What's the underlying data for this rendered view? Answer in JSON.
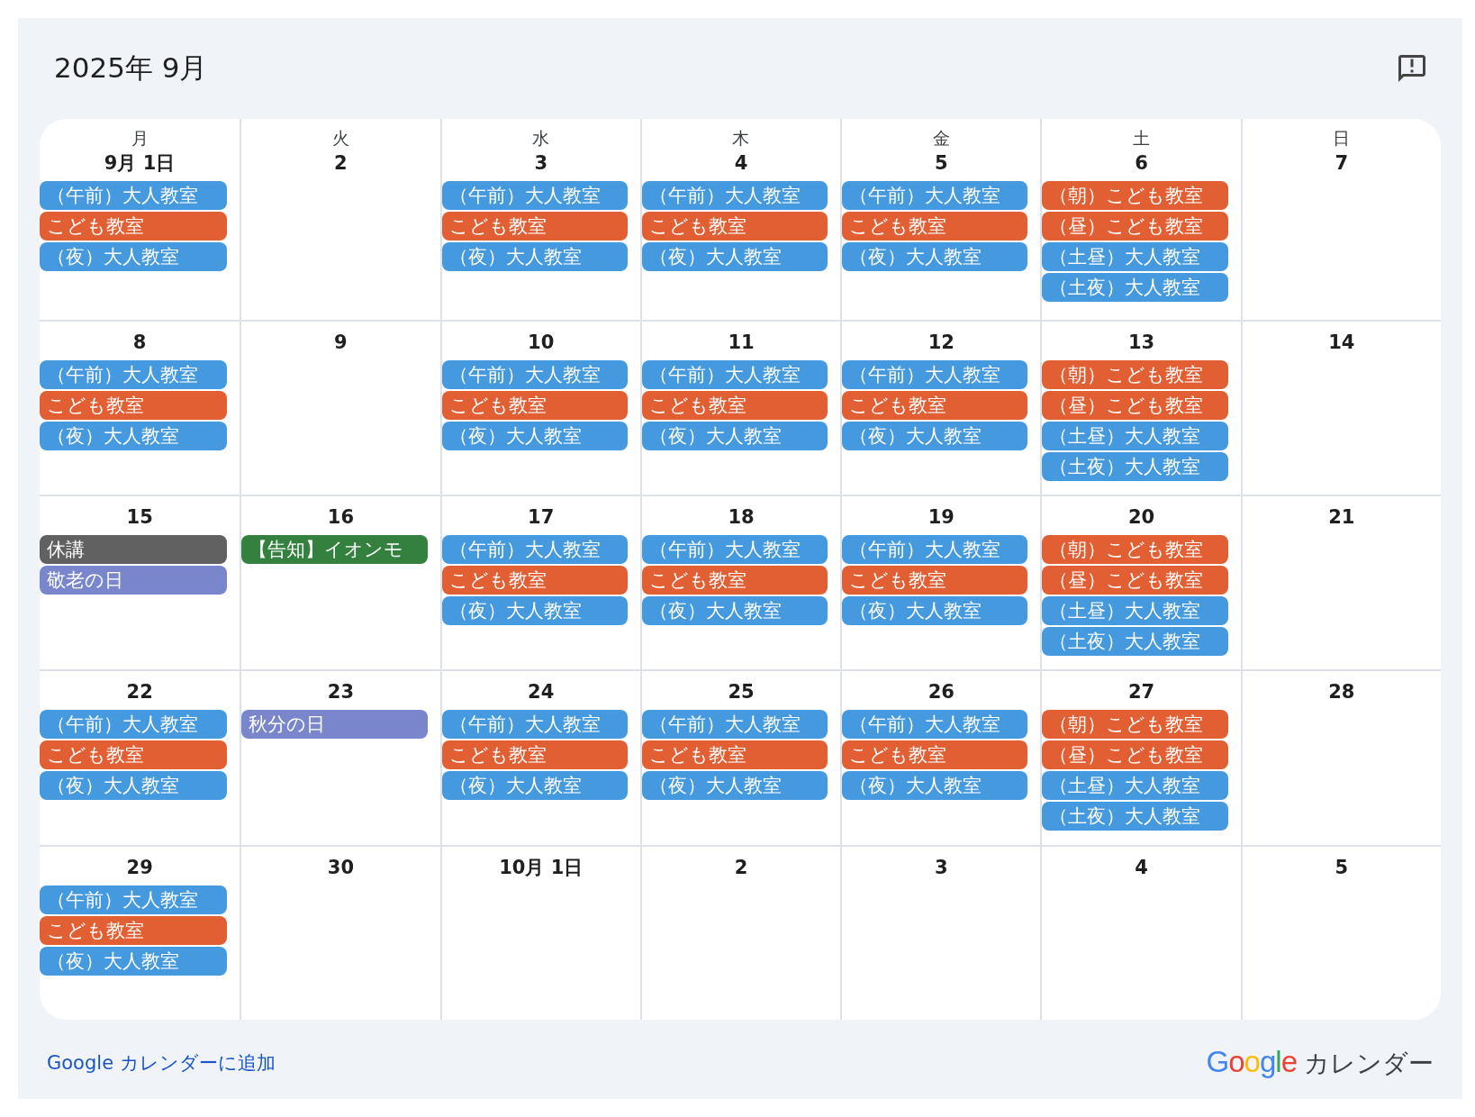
{
  "title": "2025年 9月",
  "weekdays": [
    "月",
    "火",
    "水",
    "木",
    "金",
    "土",
    "日"
  ],
  "weeks": [
    {
      "days": [
        {
          "label": "9月 1日",
          "events": [
            {
              "title": "（午前）大人教室",
              "color": "#4599df"
            },
            {
              "title": "こども教室",
              "color": "#e25e33"
            },
            {
              "title": "（夜）大人教室",
              "color": "#4599df"
            }
          ]
        },
        {
          "label": "2"
        },
        {
          "label": "3",
          "events": [
            {
              "title": "（午前）大人教室",
              "color": "#4599df"
            },
            {
              "title": "こども教室",
              "color": "#e25e33"
            },
            {
              "title": "（夜）大人教室",
              "color": "#4599df"
            }
          ]
        },
        {
          "label": "4",
          "events": [
            {
              "title": "（午前）大人教室",
              "color": "#4599df"
            },
            {
              "title": "こども教室",
              "color": "#e25e33"
            },
            {
              "title": "（夜）大人教室",
              "color": "#4599df"
            }
          ]
        },
        {
          "label": "5",
          "events": [
            {
              "title": "（午前）大人教室",
              "color": "#4599df"
            },
            {
              "title": "こども教室",
              "color": "#e25e33"
            },
            {
              "title": "（夜）大人教室",
              "color": "#4599df"
            }
          ]
        },
        {
          "label": "6",
          "events": [
            {
              "title": "（朝）こども教室",
              "color": "#e25e33"
            },
            {
              "title": "（昼）こども教室",
              "color": "#e25e33"
            },
            {
              "title": "（土昼）大人教室",
              "color": "#4599df"
            },
            {
              "title": "（土夜）大人教室",
              "color": "#4599df"
            }
          ]
        },
        {
          "label": "7"
        }
      ]
    },
    {
      "days": [
        {
          "label": "8",
          "events": [
            {
              "title": "（午前）大人教室",
              "color": "#4599df"
            },
            {
              "title": "こども教室",
              "color": "#e25e33"
            },
            {
              "title": "（夜）大人教室",
              "color": "#4599df"
            }
          ]
        },
        {
          "label": "9"
        },
        {
          "label": "10",
          "events": [
            {
              "title": "（午前）大人教室",
              "color": "#4599df"
            },
            {
              "title": "こども教室",
              "color": "#e25e33"
            },
            {
              "title": "（夜）大人教室",
              "color": "#4599df"
            }
          ]
        },
        {
          "label": "11",
          "events": [
            {
              "title": "（午前）大人教室",
              "color": "#4599df"
            },
            {
              "title": "こども教室",
              "color": "#e25e33"
            },
            {
              "title": "（夜）大人教室",
              "color": "#4599df"
            }
          ]
        },
        {
          "label": "12",
          "events": [
            {
              "title": "（午前）大人教室",
              "color": "#4599df"
            },
            {
              "title": "こども教室",
              "color": "#e25e33"
            },
            {
              "title": "（夜）大人教室",
              "color": "#4599df"
            }
          ]
        },
        {
          "label": "13",
          "events": [
            {
              "title": "（朝）こども教室",
              "color": "#e25e33"
            },
            {
              "title": "（昼）こども教室",
              "color": "#e25e33"
            },
            {
              "title": "（土昼）大人教室",
              "color": "#4599df"
            },
            {
              "title": "（土夜）大人教室",
              "color": "#4599df"
            }
          ]
        },
        {
          "label": "14"
        }
      ]
    },
    {
      "days": [
        {
          "label": "15",
          "events": [
            {
              "title": "休講",
              "color": "#616161"
            },
            {
              "title": "敬老の日",
              "color": "#7986cb"
            }
          ]
        },
        {
          "label": "16",
          "events": [
            {
              "title": "【告知】イオンモ",
              "color": "#33803f"
            }
          ]
        },
        {
          "label": "17",
          "events": [
            {
              "title": "（午前）大人教室",
              "color": "#4599df"
            },
            {
              "title": "こども教室",
              "color": "#e25e33"
            },
            {
              "title": "（夜）大人教室",
              "color": "#4599df"
            }
          ]
        },
        {
          "label": "18",
          "events": [
            {
              "title": "（午前）大人教室",
              "color": "#4599df"
            },
            {
              "title": "こども教室",
              "color": "#e25e33"
            },
            {
              "title": "（夜）大人教室",
              "color": "#4599df"
            }
          ]
        },
        {
          "label": "19",
          "events": [
            {
              "title": "（午前）大人教室",
              "color": "#4599df"
            },
            {
              "title": "こども教室",
              "color": "#e25e33"
            },
            {
              "title": "（夜）大人教室",
              "color": "#4599df"
            }
          ]
        },
        {
          "label": "20",
          "events": [
            {
              "title": "（朝）こども教室",
              "color": "#e25e33"
            },
            {
              "title": "（昼）こども教室",
              "color": "#e25e33"
            },
            {
              "title": "（土昼）大人教室",
              "color": "#4599df"
            },
            {
              "title": "（土夜）大人教室",
              "color": "#4599df"
            }
          ]
        },
        {
          "label": "21"
        }
      ]
    },
    {
      "days": [
        {
          "label": "22",
          "events": [
            {
              "title": "（午前）大人教室",
              "color": "#4599df"
            },
            {
              "title": "こども教室",
              "color": "#e25e33"
            },
            {
              "title": "（夜）大人教室",
              "color": "#4599df"
            }
          ]
        },
        {
          "label": "23",
          "events": [
            {
              "title": "秋分の日",
              "color": "#7986cb"
            }
          ]
        },
        {
          "label": "24",
          "events": [
            {
              "title": "（午前）大人教室",
              "color": "#4599df"
            },
            {
              "title": "こども教室",
              "color": "#e25e33"
            },
            {
              "title": "（夜）大人教室",
              "color": "#4599df"
            }
          ]
        },
        {
          "label": "25",
          "events": [
            {
              "title": "（午前）大人教室",
              "color": "#4599df"
            },
            {
              "title": "こども教室",
              "color": "#e25e33"
            },
            {
              "title": "（夜）大人教室",
              "color": "#4599df"
            }
          ]
        },
        {
          "label": "26",
          "events": [
            {
              "title": "（午前）大人教室",
              "color": "#4599df"
            },
            {
              "title": "こども教室",
              "color": "#e25e33"
            },
            {
              "title": "（夜）大人教室",
              "color": "#4599df"
            }
          ]
        },
        {
          "label": "27",
          "events": [
            {
              "title": "（朝）こども教室",
              "color": "#e25e33"
            },
            {
              "title": "（昼）こども教室",
              "color": "#e25e33"
            },
            {
              "title": "（土昼）大人教室",
              "color": "#4599df"
            },
            {
              "title": "（土夜）大人教室",
              "color": "#4599df"
            }
          ]
        },
        {
          "label": "28"
        }
      ]
    },
    {
      "days": [
        {
          "label": "29",
          "events": [
            {
              "title": "（午前）大人教室",
              "color": "#4599df"
            },
            {
              "title": "こども教室",
              "color": "#e25e33"
            },
            {
              "title": "（夜）大人教室",
              "color": "#4599df"
            }
          ]
        },
        {
          "label": "30"
        },
        {
          "label": "10月 1日"
        },
        {
          "label": "2"
        },
        {
          "label": "3"
        },
        {
          "label": "4"
        },
        {
          "label": "5"
        }
      ]
    }
  ],
  "footer": {
    "add_link": "Google カレンダーに追加",
    "logo": "Google",
    "product": "カレンダー"
  }
}
